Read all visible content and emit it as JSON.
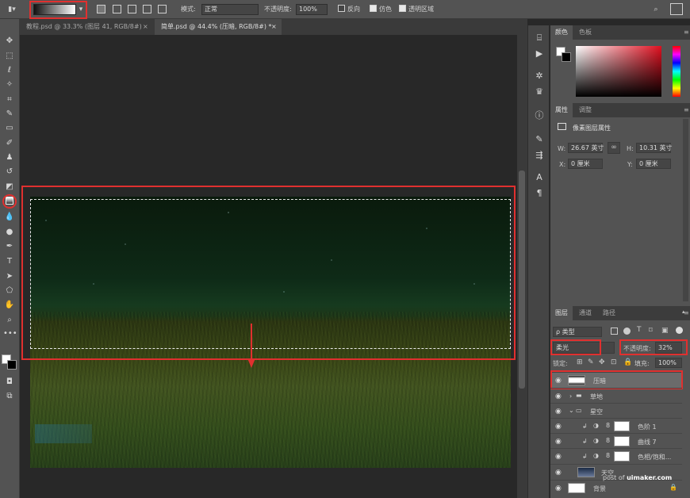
{
  "options_bar": {
    "mode_label": "模式:",
    "mode_value": "正常",
    "opacity_label": "不透明度:",
    "opacity_value": "100%",
    "reverse_label": "反向",
    "dither_label": "仿色",
    "transparency_label": "透明区域",
    "reverse_checked": false,
    "dither_checked": true,
    "transparency_checked": true
  },
  "tabs": [
    {
      "label": "教程.psd @ 33.3% (图层 41, RGB/8#)",
      "active": false
    },
    {
      "label": "简单.psd @ 44.4% (压暗, RGB/8#) *",
      "active": true
    }
  ],
  "color_panel": {
    "tabs": [
      "颜色",
      "色板"
    ]
  },
  "properties_panel": {
    "tabs": [
      "属性",
      "调整"
    ],
    "title": "像素图层属性",
    "w_label": "W:",
    "w_value": "26.67 英寸",
    "h_label": "H:",
    "h_value": "10.31 英寸",
    "x_label": "X:",
    "x_value": "0 厘米",
    "y_label": "Y:",
    "y_value": "0 厘米"
  },
  "layers_panel": {
    "tabs": [
      "图层",
      "通道",
      "路径"
    ],
    "filter_label": "ρ 类型",
    "blend_mode": "柔光",
    "opacity_label": "不透明度:",
    "opacity_value": "32%",
    "lock_label": "锁定:",
    "fill_label": "填充:",
    "fill_value": "100%",
    "layers": [
      {
        "name": "压暗",
        "type": "pixel",
        "selected": true
      },
      {
        "name": "草地",
        "type": "group",
        "collapsed": true
      },
      {
        "name": "星空",
        "type": "group",
        "collapsed": false
      },
      {
        "name": "色阶 1",
        "type": "adjustment"
      },
      {
        "name": "曲线 7",
        "type": "adjustment"
      },
      {
        "name": "色相/饱和...",
        "type": "adjustment"
      },
      {
        "name": "天空",
        "type": "pixel"
      },
      {
        "name": "背景",
        "type": "background"
      }
    ]
  },
  "credit": {
    "prefix": "post of",
    "site": "uimaker.com"
  },
  "colors": {
    "highlight": "#e0302f",
    "panel_bg": "#535353",
    "canvas_bg": "#282828"
  }
}
